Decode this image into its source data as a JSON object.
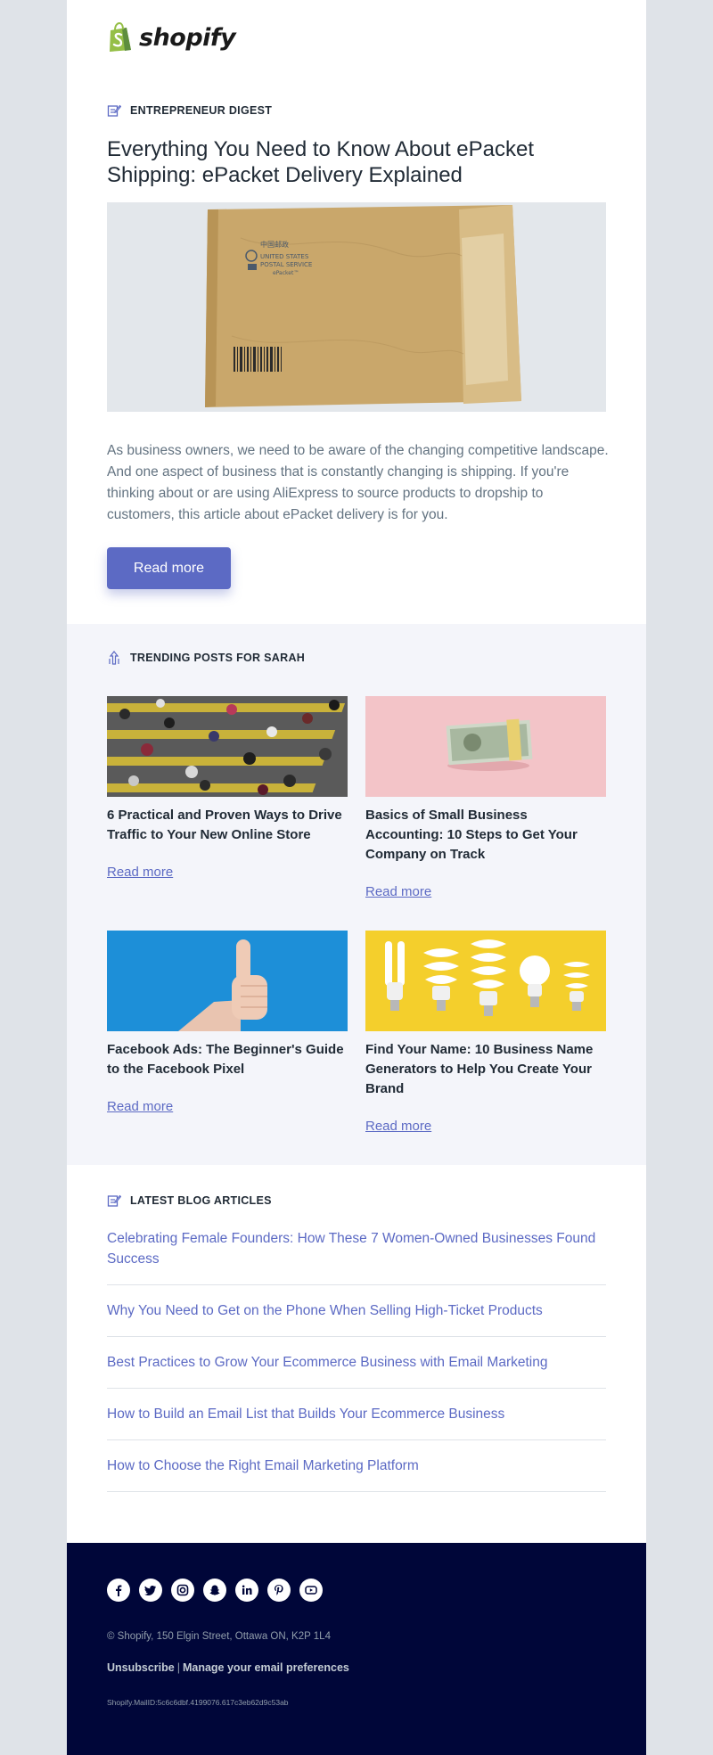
{
  "brand": {
    "wordmark": "shopify",
    "accent": "#5c6ac4",
    "logo_green": "#95bf47"
  },
  "digest": {
    "label": "Entrepreneur Digest",
    "title": "Everything You Need to Know About ePacket Shipping: ePacket Delivery Explained",
    "envelope_text": [
      "中国邮政",
      "UNITED STATES",
      "POSTAL SERVICE",
      "ePacket™"
    ],
    "body": "As business owners, we need to be aware of the changing competitive landscape. And one aspect of business that is constantly changing is shipping.  If you're thinking about or are using AliExpress to source products to dropship to customers, this article about ePacket delivery is for you.",
    "button": "Read more"
  },
  "trending": {
    "label": "Trending posts for Sarah",
    "posts": [
      {
        "title": "6 Practical and Proven Ways to Drive Traffic to Your New Online Store",
        "link": "Read more"
      },
      {
        "title": "Basics of Small Business Accounting: 10 Steps to Get Your Company on Track",
        "link": "Read more"
      },
      {
        "title": "Facebook Ads: The Beginner's Guide to the Facebook Pixel",
        "link": "Read more"
      },
      {
        "title": "Find Your Name: 10 Business Name Generators to Help You Create Your Brand",
        "link": "Read more"
      }
    ]
  },
  "latest": {
    "label": "Latest blog articles",
    "articles": [
      "Celebrating Female Founders: How These 7 Women-Owned Businesses Found Success",
      "Why You Need to Get on the Phone When Selling High-Ticket Products",
      "Best Practices to Grow Your Ecommerce Business with Email Marketing",
      "How to Build an Email List that Builds Your Ecommerce Business",
      "How to Choose the Right Email Marketing Platform"
    ]
  },
  "footer": {
    "social_icons": [
      "facebook-icon",
      "twitter-icon",
      "instagram-icon",
      "snapchat-icon",
      "linkedin-icon",
      "pinterest-icon",
      "youtube-icon"
    ],
    "address": "© Shopify,  150 Elgin Street, Ottawa ON, K2P 1L4",
    "unsubscribe": "Unsubscribe",
    "separator": "|",
    "manage": "Manage your email preferences",
    "mail_id": "Shopify.MailID:5c6c6dbf.4199076.617c3eb62d9c53ab",
    "background": "#000639"
  }
}
